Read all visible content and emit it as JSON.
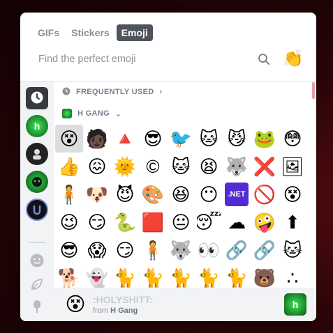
{
  "tabs": [
    {
      "label": "GIFs",
      "active": false
    },
    {
      "label": "Stickers",
      "active": false
    },
    {
      "label": "Emoji",
      "active": true
    }
  ],
  "search": {
    "placeholder": "Find the perfect emoji"
  },
  "skin_tone_button": {
    "icon": "clapping-hands-icon",
    "glyph": "👏"
  },
  "sidebar": {
    "categories": [
      {
        "name": "recent",
        "icon": "clock-icon"
      },
      {
        "name": "h-gang-server",
        "icon": "h-gang-server-icon"
      },
      {
        "name": "server-2",
        "icon": "server-icon"
      },
      {
        "name": "server-3",
        "icon": "server-icon"
      },
      {
        "name": "server-4",
        "icon": "server-icon"
      }
    ],
    "unicode_categories": [
      {
        "name": "people",
        "icon": "smiley-icon"
      },
      {
        "name": "nature",
        "icon": "leaf-icon"
      },
      {
        "name": "food",
        "icon": "popsicle-icon"
      },
      {
        "name": "activities",
        "icon": "gamepad-icon"
      }
    ]
  },
  "sections": {
    "frequently_used": "FREQUENTLY USED",
    "h_gang": "H GANG"
  },
  "emoji_rows": [
    [
      "😵",
      "🧑🏿",
      "🔺",
      "😎",
      "🐦",
      "🐱",
      "😼",
      "🐸",
      "😳"
    ],
    [
      "👍",
      "😖",
      "🌞",
      "©",
      "🐱",
      "😫",
      "🐺",
      "❌",
      "🖼"
    ],
    [
      "🧍",
      "🐶",
      "😈",
      "🎨",
      "😆",
      "😶",
      ".NET",
      "🚫",
      "😵"
    ],
    [
      "😉",
      "😏",
      "🐍",
      "🟥",
      "😐",
      "😴",
      "☁",
      "🤪",
      "⬆"
    ],
    [
      "😎",
      "😱",
      "😏",
      "🧍",
      "🐺",
      "👀",
      "🔗",
      "🔗",
      "🐱"
    ],
    [
      "🐕",
      "👻",
      "🐈",
      "🐈",
      "🐈",
      "🐈",
      "🐈",
      "🐻",
      "∴"
    ]
  ],
  "preview": {
    "name": ":HOLYSHITT:",
    "from_prefix": "from",
    "server": "H Gang",
    "glyph": "😵",
    "server_icon_letter": "h"
  }
}
